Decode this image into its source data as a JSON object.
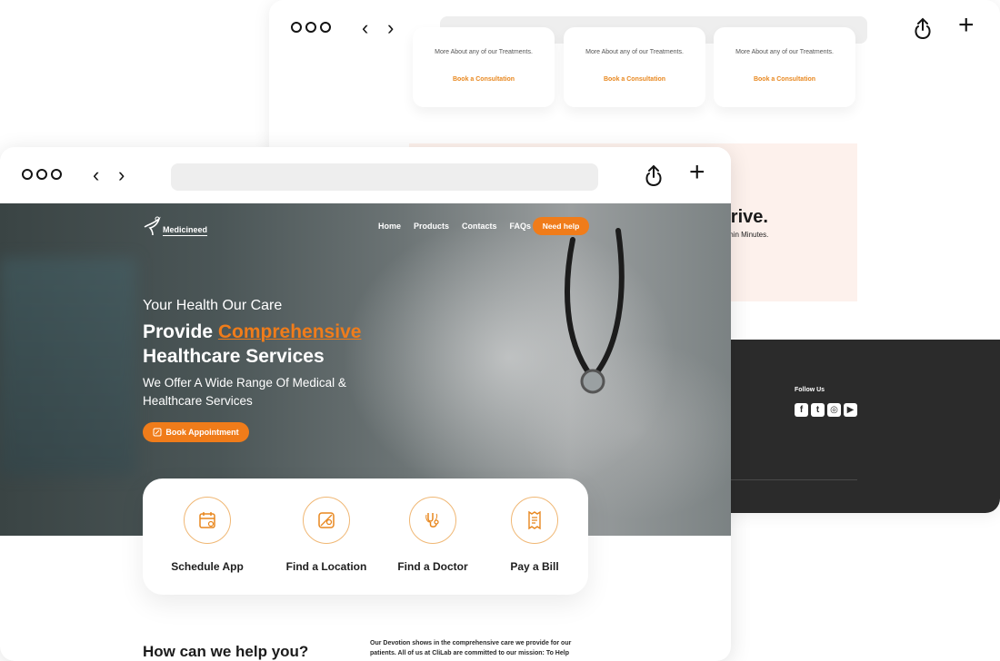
{
  "back_window": {
    "cards": [
      {
        "text": "More About any of our Treatments.",
        "link": "Book a Consultation"
      },
      {
        "text": "More About any of our Treatments.",
        "link": "Book a Consultation"
      },
      {
        "text": "More About any of our Treatments.",
        "link": "Book a Consultation"
      }
    ],
    "banner": {
      "heading": "rrive.",
      "subtext": "thin Minutes."
    },
    "footer": {
      "follow_label": "Follow Us",
      "socials": [
        "facebook-icon",
        "twitter-icon",
        "instagram-icon",
        "youtube-icon"
      ]
    }
  },
  "front_window": {
    "nav": {
      "logo": "Medicineed",
      "items": [
        "Home",
        "Products",
        "Contacts",
        "FAQs"
      ],
      "cta": "Need help"
    },
    "hero": {
      "tagline": "Your Health Our Care",
      "headline_prefix": "Provide ",
      "headline_accent": "Comprehensive",
      "headline_line2": "Healthcare Services",
      "subheading": "We Offer A Wide Range Of Medical & Healthcare Services",
      "button": "Book Appointment"
    },
    "services": [
      {
        "label": "Schedule App",
        "icon": "calendar-icon"
      },
      {
        "label": "Find a Location",
        "icon": "map-icon"
      },
      {
        "label": "Find a Doctor",
        "icon": "stethoscope-icon"
      },
      {
        "label": "Pay a Bill",
        "icon": "receipt-icon"
      }
    ],
    "help": {
      "heading": "How can we help you?",
      "text": "Our Devotion shows in the comprehensive care we provide for our patients. All of us at CliLab are committed to our mission: To Help"
    }
  },
  "colors": {
    "accent": "#f07c1a",
    "footer": "#2b2b2b",
    "banner": "#fdf1ec"
  }
}
